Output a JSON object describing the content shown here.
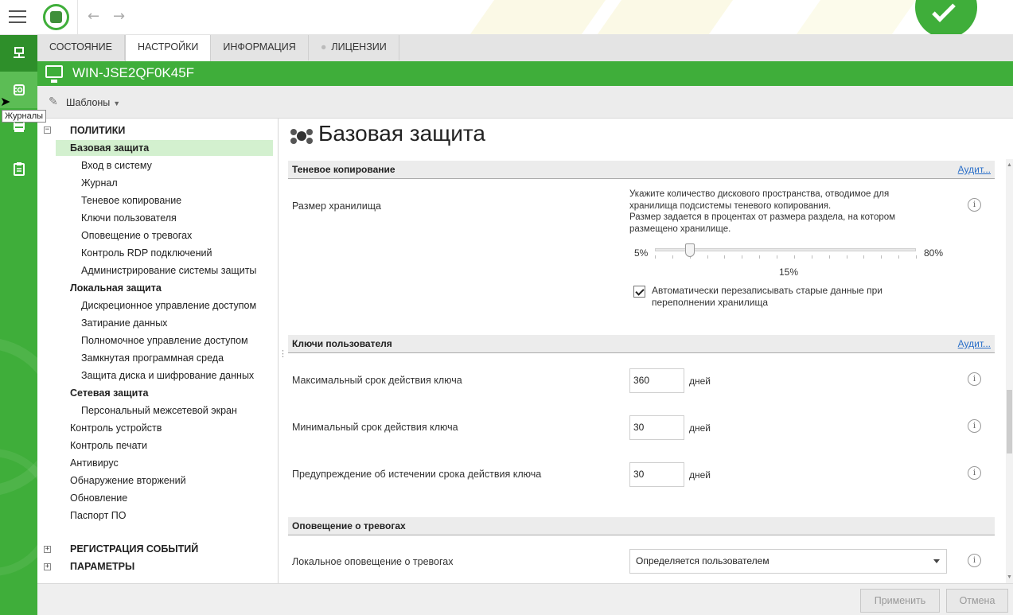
{
  "topbar": {
    "back_icon": "arrow-left-icon",
    "forward_icon": "arrow-right-icon",
    "status_icon": "checkmark-icon",
    "status_color": "#3fae3a"
  },
  "rail": {
    "items": [
      {
        "icon": "computer-network-icon"
      },
      {
        "icon": "journals-icon"
      },
      {
        "icon": "database-icon"
      },
      {
        "icon": "clipboard-icon"
      }
    ],
    "tooltip": "Журналы"
  },
  "tabs": [
    {
      "label": "СОСТОЯНИЕ"
    },
    {
      "label": "НАСТРОЙКИ"
    },
    {
      "label": "ИНФОРМАЦИЯ"
    },
    {
      "label": "ЛИЦЕНЗИИ"
    }
  ],
  "host": {
    "name": "WIN-JSE2QF0K45F"
  },
  "toolbar": {
    "templates_label": "Шаблоны"
  },
  "tree": {
    "policies": "ПОЛИТИКИ",
    "items": [
      "Базовая защита",
      "Вход в систему",
      "Журнал",
      "Теневое копирование",
      "Ключи пользователя",
      "Оповещение о тревогах",
      "Контроль RDP подключений",
      "Администрирование системы защиты",
      "Локальная защита",
      "Дискреционное управление доступом",
      "Затирание данных",
      "Полномочное управление доступом",
      "Замкнутая программная среда",
      "Защита диска и шифрование данных",
      "Сетевая защита",
      "Персональный межсетевой экран",
      "Контроль устройств",
      "Контроль печати",
      "Антивирус",
      "Обнаружение вторжений",
      "Обновление",
      "Паспорт ПО"
    ],
    "events": "РЕГИСТРАЦИЯ СОБЫТИЙ",
    "params": "ПАРАМЕТРЫ"
  },
  "main": {
    "title": "Базовая защита",
    "shadow": {
      "header": "Теневое копирование",
      "audit": "Аудит...",
      "storage_label": "Размер хранилища",
      "description": "Укажите количество дискового пространства, отводимое для хранилища подсистемы теневого копирования.\nРазмер задается в процентах от размера раздела, на котором размещено хранилище.",
      "slider_min": "5%",
      "slider_max": "80%",
      "slider_value": "15%",
      "slider_value_num": 15,
      "overwrite_label": "Автоматически перезаписывать старые данные при переполнении хранилища",
      "overwrite_checked": true
    },
    "keys": {
      "header": "Ключи пользователя",
      "audit": "Аудит...",
      "max_label": "Максимальный срок действия ключа",
      "max_value": "360",
      "min_label": "Минимальный срок действия ключа",
      "min_value": "30",
      "warn_label": "Предупреждение об истечении срока действия ключа",
      "warn_value": "30",
      "unit": "дней"
    },
    "alerts": {
      "header": "Оповещение о тревогах",
      "local_label": "Локальное оповещение о тревогах",
      "local_value": "Определяется пользователем"
    }
  },
  "footer": {
    "apply": "Применить",
    "cancel": "Отмена"
  }
}
